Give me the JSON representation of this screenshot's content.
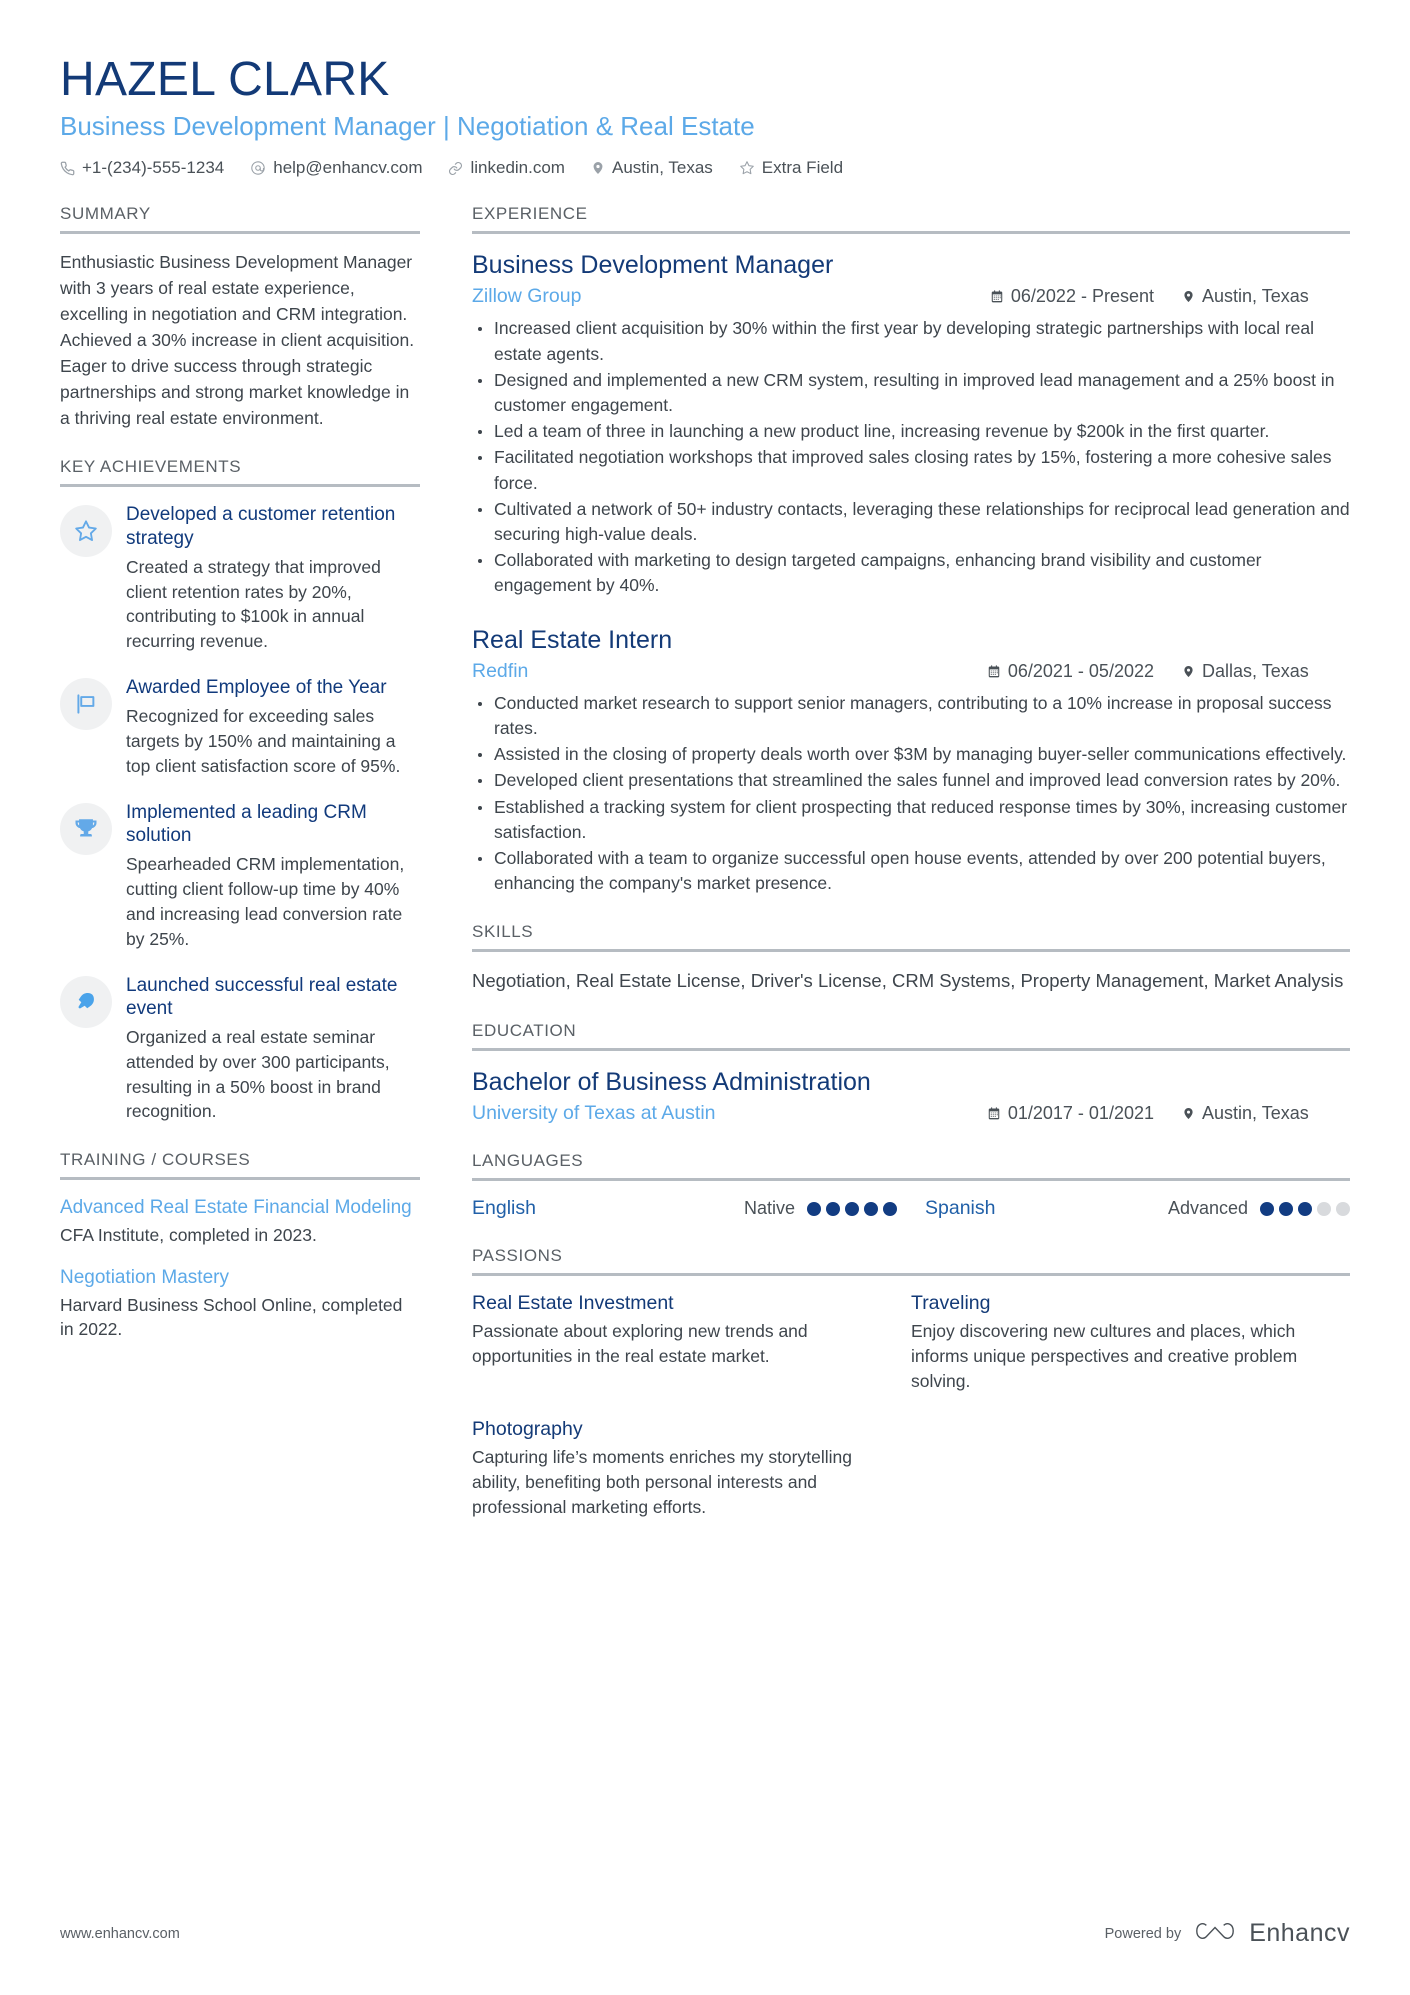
{
  "header": {
    "name": "HAZEL CLARK",
    "title": "Business Development Manager | Negotiation & Real Estate",
    "contacts": [
      {
        "icon": "phone-icon",
        "text": "+1-(234)-555-1234"
      },
      {
        "icon": "email-icon",
        "text": "help@enhancv.com"
      },
      {
        "icon": "link-icon",
        "text": "linkedin.com"
      },
      {
        "icon": "location-pin-icon",
        "text": "Austin, Texas"
      },
      {
        "icon": "star-icon",
        "text": "Extra Field"
      }
    ]
  },
  "summary": {
    "heading": "SUMMARY",
    "text": "Enthusiastic Business Development Manager with 3 years of real estate experience, excelling in negotiation and CRM integration. Achieved a 30% increase in client acquisition. Eager to drive success through strategic partnerships and strong market knowledge in a thriving real estate environment."
  },
  "key_achievements": {
    "heading": "KEY ACHIEVEMENTS",
    "items": [
      {
        "icon": "star-outline-icon",
        "title": "Developed a customer retention strategy",
        "description": "Created a strategy that improved client retention rates by 20%, contributing to $100k in annual recurring revenue."
      },
      {
        "icon": "flag-icon",
        "title": "Awarded Employee of the Year",
        "description": "Recognized for exceeding sales targets by 150% and maintaining a top client satisfaction score of 95%."
      },
      {
        "icon": "trophy-icon",
        "title": "Implemented a leading CRM solution",
        "description": "Spearheaded CRM implementation, cutting client follow-up time by 40% and increasing lead conversion rate by 25%."
      },
      {
        "icon": "rocket-icon",
        "title": "Launched successful real estate event",
        "description": "Organized a real estate seminar attended by over 300 participants, resulting in a 50% boost in brand recognition."
      }
    ]
  },
  "training": {
    "heading": "TRAINING / COURSES",
    "items": [
      {
        "title": "Advanced Real Estate Financial Modeling",
        "subtitle": "CFA Institute, completed in 2023."
      },
      {
        "title": "Negotiation Mastery",
        "subtitle": "Harvard Business School Online, completed in 2022."
      }
    ]
  },
  "experience": {
    "heading": "EXPERIENCE",
    "entries": [
      {
        "title": "Business Development Manager",
        "organization": "Zillow Group",
        "date": "06/2022 - Present",
        "location": "Austin, Texas",
        "bullets": [
          "Increased client acquisition by 30% within the first year by developing strategic partnerships with local real estate agents.",
          "Designed and implemented a new CRM system, resulting in improved lead management and a 25% boost in customer engagement.",
          "Led a team of three in launching a new product line, increasing revenue by $200k in the first quarter.",
          "Facilitated negotiation workshops that improved sales closing rates by 15%, fostering a more cohesive sales force.",
          "Cultivated a network of 50+ industry contacts, leveraging these relationships for reciprocal lead generation and securing high-value deals.",
          "Collaborated with marketing to design targeted campaigns, enhancing brand visibility and customer engagement by 40%."
        ]
      },
      {
        "title": "Real Estate Intern",
        "organization": "Redfin",
        "date": "06/2021 - 05/2022",
        "location": "Dallas, Texas",
        "bullets": [
          "Conducted market research to support senior managers, contributing to a 10% increase in proposal success rates.",
          "Assisted in the closing of property deals worth over $3M by managing buyer-seller communications effectively.",
          "Developed client presentations that streamlined the sales funnel and improved lead conversion rates by 20%.",
          "Established a tracking system for client prospecting that reduced response times by 30%, increasing customer satisfaction.",
          "Collaborated with a team to organize successful open house events, attended by over 200 potential buyers, enhancing the company's market presence."
        ]
      }
    ]
  },
  "skills": {
    "heading": "SKILLS",
    "text": "Negotiation, Real Estate License, Driver's License, CRM Systems, Property Management, Market Analysis"
  },
  "education": {
    "heading": "EDUCATION",
    "entries": [
      {
        "degree": "Bachelor of Business Administration",
        "school": "University of Texas at Austin",
        "date": "01/2017 - 01/2021",
        "location": "Austin, Texas"
      }
    ]
  },
  "languages": {
    "heading": "LANGUAGES",
    "items": [
      {
        "name": "English",
        "level": "Native",
        "filled": 5,
        "total": 5
      },
      {
        "name": "Spanish",
        "level": "Advanced",
        "filled": 3,
        "total": 5
      }
    ]
  },
  "passions": {
    "heading": "PASSIONS",
    "items": [
      {
        "title": "Real Estate Investment",
        "description": "Passionate about exploring new trends and opportunities in the real estate market."
      },
      {
        "title": "Traveling",
        "description": "Enjoy discovering new cultures and places, which informs unique perspectives and creative problem solving."
      },
      {
        "title": "Photography",
        "description": "Capturing life’s moments enriches my storytelling ability, benefiting both personal interests and professional marketing efforts."
      }
    ]
  },
  "footer": {
    "url": "www.enhancv.com",
    "powered_by": "Powered by",
    "brand": "Enhancv"
  },
  "colors": {
    "name_blue": "#133a77",
    "title_blue": "#5ca9e8",
    "accent_light_blue": "#5ca9e8",
    "heading_gray": "#5a6066",
    "body_gray": "#3e454c",
    "rule_gray": "#b6bcc2",
    "dot_on": "#123c82",
    "dot_off": "#d8dadd"
  }
}
